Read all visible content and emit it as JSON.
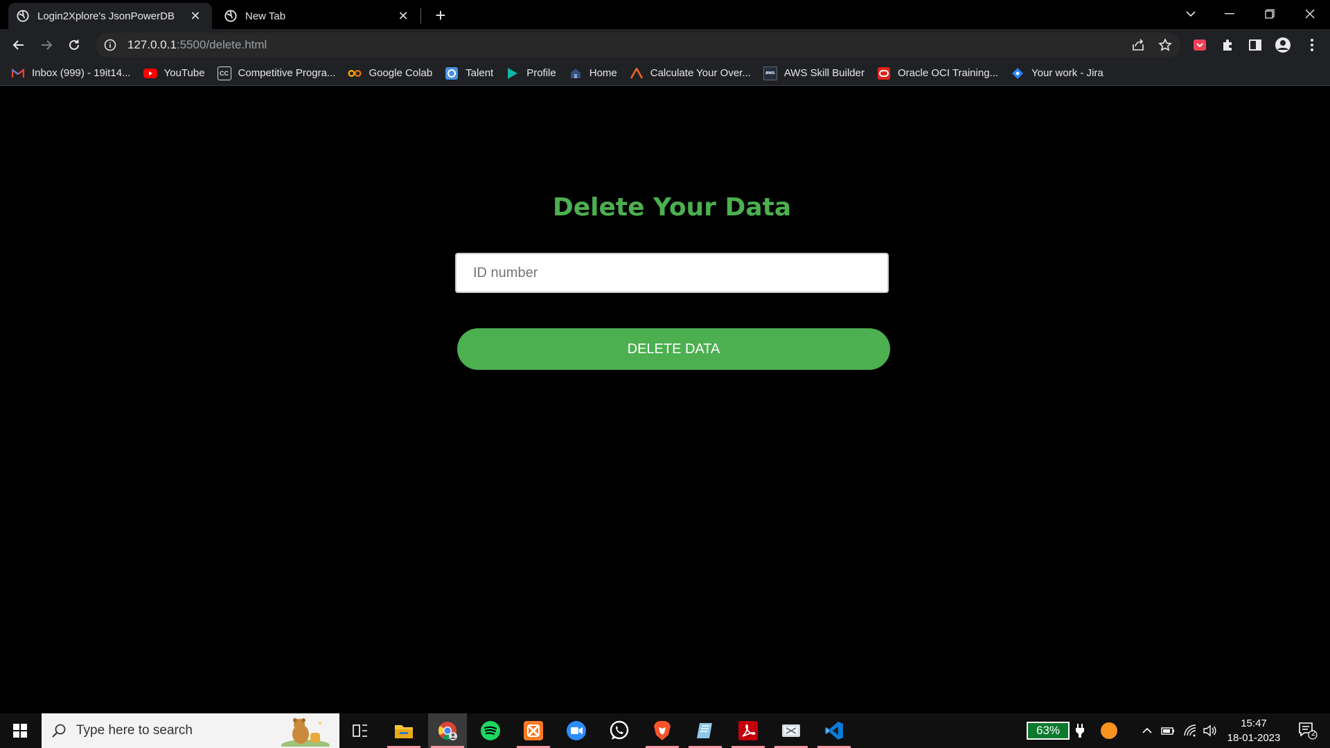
{
  "browser": {
    "tabs": [
      {
        "label": "Login2Xplore's JsonPowerDB",
        "active": true
      },
      {
        "label": "New Tab",
        "active": false
      }
    ],
    "url_host": "127.0.0.1",
    "url_rest": ":5500/delete.html",
    "bookmarks": [
      {
        "label": "Inbox (999) - 19it14...",
        "icon": "gmail-icon"
      },
      {
        "label": "YouTube",
        "icon": "youtube-icon"
      },
      {
        "label": "Competitive Progra...",
        "icon": "codechef-icon"
      },
      {
        "label": "Google Colab",
        "icon": "colab-icon"
      },
      {
        "label": "Talent",
        "icon": "talent-icon"
      },
      {
        "label": "Profile",
        "icon": "profile-play-icon"
      },
      {
        "label": "Home",
        "icon": "home-icon"
      },
      {
        "label": "Calculate Your Over...",
        "icon": "calculate-icon"
      },
      {
        "label": "AWS Skill Builder",
        "icon": "aws-icon"
      },
      {
        "label": "Oracle OCI Training...",
        "icon": "oracle-icon"
      },
      {
        "label": "Your work - Jira",
        "icon": "jira-icon"
      }
    ]
  },
  "page": {
    "title": "Delete Your Data",
    "id_placeholder": "ID number",
    "delete_label": "DELETE DATA",
    "accent_color": "#4caf50"
  },
  "taskbar": {
    "search_placeholder": "Type here to search",
    "battery": "63%",
    "time": "15:47",
    "date": "18-01-2023",
    "notification_count": "2"
  }
}
